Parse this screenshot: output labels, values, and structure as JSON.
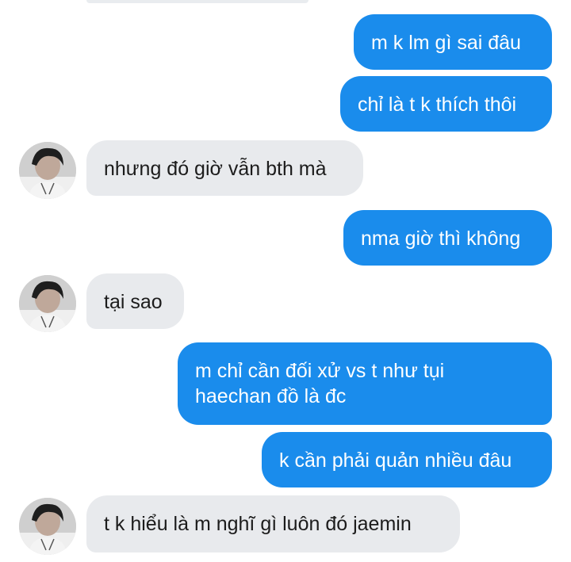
{
  "colors": {
    "outgoing_bubble": "#1a8cec",
    "incoming_bubble": "#e8eaed",
    "outgoing_text": "#ffffff",
    "incoming_text": "#1c1c1c"
  },
  "messages": [
    {
      "side": "out",
      "text": "m k lm gì sai đâu"
    },
    {
      "side": "out",
      "text": "chỉ là t k thích thôi"
    },
    {
      "side": "in",
      "text": "nhưng đó giờ vẫn bth mà",
      "avatar_icon": "profile-photo-icon"
    },
    {
      "side": "out",
      "text": "nma giờ thì không"
    },
    {
      "side": "in",
      "text": "tại sao",
      "avatar_icon": "profile-photo-icon"
    },
    {
      "side": "out",
      "text_line1": "m chỉ cần đối xử vs t như tụi",
      "text_line2": "haechan đồ là đc"
    },
    {
      "side": "out",
      "text": "k cần phải quản nhiều đâu"
    },
    {
      "side": "in",
      "text": "t k hiểu là m nghĩ gì luôn đó jaemin",
      "avatar_icon": "profile-photo-icon"
    }
  ]
}
